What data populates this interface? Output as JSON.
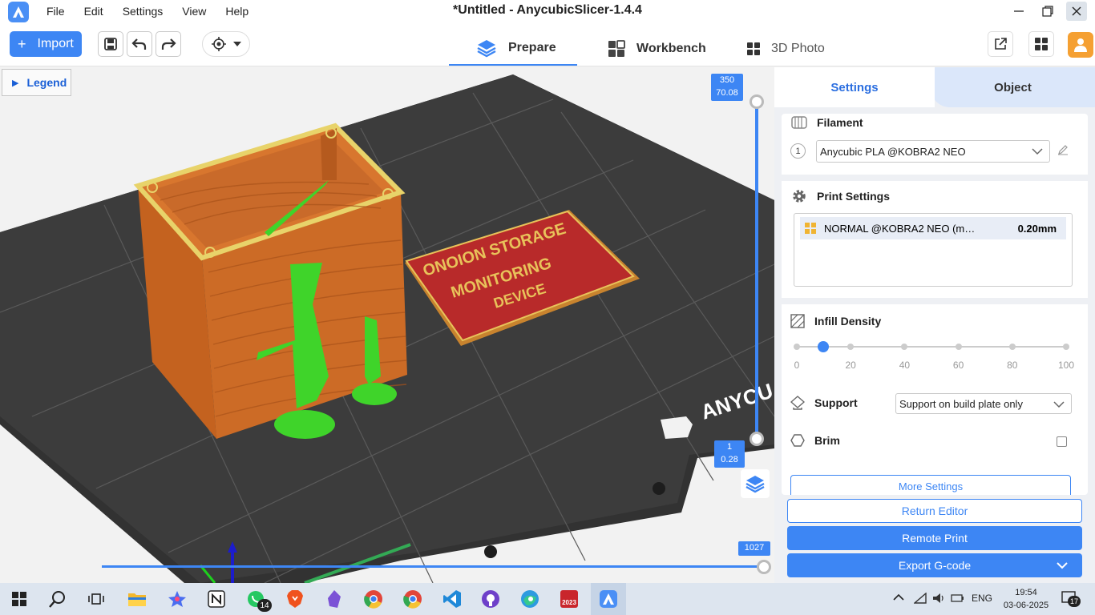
{
  "window": {
    "title": "*Untitled - AnycubicSlicer-1.4.4",
    "menu": [
      "File",
      "Edit",
      "Settings",
      "View",
      "Help"
    ]
  },
  "toolbar": {
    "import_label": "Import",
    "tabs": [
      {
        "label": "Prepare",
        "active": true
      },
      {
        "label": "Workbench",
        "active": false
      },
      {
        "label": "3D Photo",
        "active": false
      }
    ]
  },
  "viewport": {
    "legend_label": "Legend",
    "layer_top_value": "350",
    "layer_top_height": "70.08",
    "layer_bottom_value": "1",
    "layer_bottom_height": "0.28",
    "horizontal_value": "1027",
    "bed_brand_text": "ANYCU",
    "plate_text": [
      "ONOION STORAGE",
      "MONITORING",
      "DEVICE"
    ]
  },
  "panel": {
    "tabs": [
      "Settings",
      "Object"
    ],
    "filament": {
      "title": "Filament",
      "index": "1",
      "selected": "Anycubic PLA @KOBRA2 NEO"
    },
    "print_settings": {
      "title": "Print Settings",
      "profile": "NORMAL @KOBRA2 NEO (m…",
      "layer_height": "0.20mm"
    },
    "infill": {
      "title": "Infill Density",
      "ticks": [
        "0",
        "20",
        "40",
        "60",
        "80",
        "100"
      ],
      "value_percent": 10
    },
    "support": {
      "title": "Support",
      "selected": "Support on build plate only"
    },
    "brim": {
      "title": "Brim",
      "checked": false
    },
    "more_settings_label": "More Settings",
    "return_editor_label": "Return Editor",
    "remote_print_label": "Remote Print",
    "export_gcode_label": "Export G-code"
  },
  "taskbar": {
    "language": "ENG",
    "time": "19:54",
    "date": "03-06-2025",
    "whatsapp_badge": "14",
    "notification_count": "17",
    "solidworks_label": "2023"
  },
  "colors": {
    "accent": "#3d86f4",
    "bed": "#3a3a3a",
    "box_orange": "#c96a2a",
    "plate_red": "#b82a2a",
    "model_green": "#3fd42a"
  }
}
